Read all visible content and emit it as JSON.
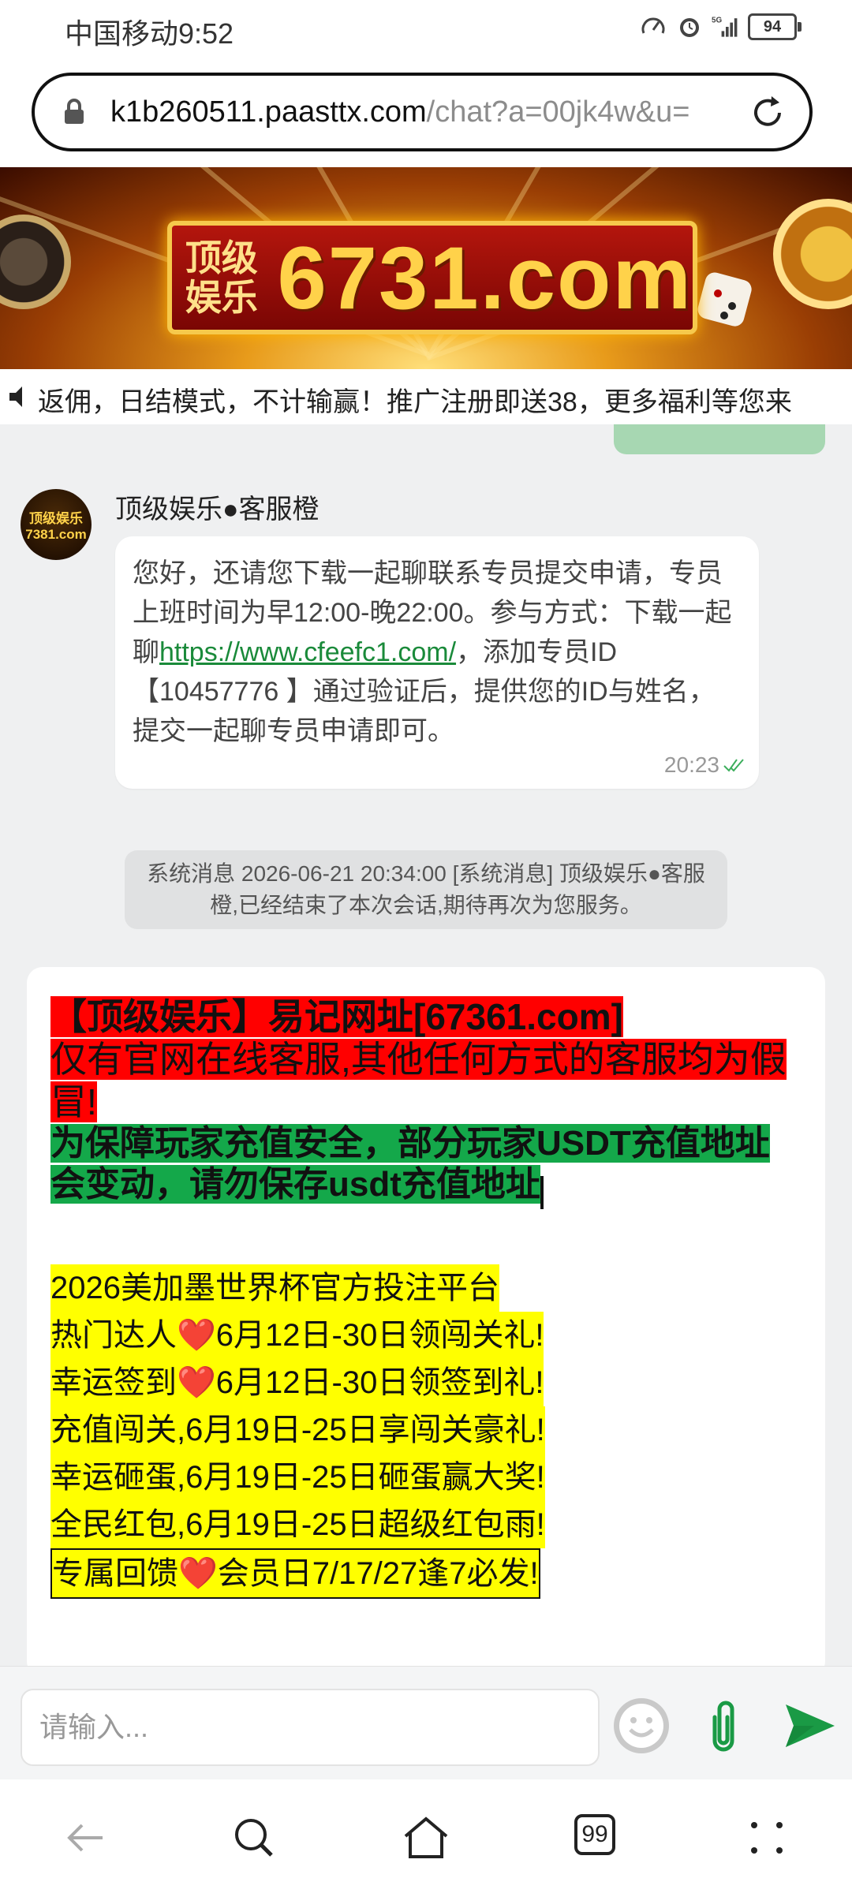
{
  "status_bar": {
    "carrier_time": "中国移动9:52",
    "network": "5G",
    "battery": "94"
  },
  "browser": {
    "url_host": "k1b260511.paasttx.com",
    "url_path": "/chat?a=00jk4w&u="
  },
  "banner": {
    "small_text": "顶级娱乐",
    "big_text": "6731.com"
  },
  "marquee": {
    "text": "返佣，日结模式，不计输赢！推广注册即送38，更多福利等您来"
  },
  "chat": {
    "agent_message": {
      "avatar_text": "顶级娱乐 7381.com",
      "sender": "顶级娱乐●客服橙",
      "text_before_link": "您好，还请您下载一起聊联系专员提交申请，专员上班时间为早12:00-晚22:00。参与方式：下载一起聊",
      "link": "https://www.cfeefc1.com/",
      "text_after_link": "，添加专员ID【10457776 】通过验证后，提供您的ID与姓名，提交一起聊专员申请即可。",
      "time": "20:23"
    },
    "system_message": "系统消息 2026-06-21 20:34:00 [系统消息] 顶级娱乐●客服橙,已经结束了本次会话,期待再次为您服务。",
    "notice": {
      "red_line1": "【顶级娱乐】易记网址[67361.com]",
      "red_line2": "仅有官网在线客服,其他任何方式的客服均为假冒!",
      "green_text": "为保障玩家充值安全，部分玩家USDT充值地址会变动，请勿保存usdt充值地址",
      "yellow_lines": [
        "2026美加墨世界杯官方投注平台",
        "热门达人❤️6月12日-30日领闯关礼!",
        "幸运签到❤️6月12日-30日领签到礼!",
        "充值闯关,6月19日-25日享闯关豪礼!",
        "幸运砸蛋,6月19日-25日砸蛋赢大奖!",
        "全民红包,6月19日-25日超级红包雨!",
        "专属回馈❤️会员日7/17/27逢7必发!"
      ]
    }
  },
  "composer": {
    "placeholder": "请输入..."
  },
  "nav": {
    "tab_count": "99"
  },
  "colors": {
    "brand_green": "#1a9a45",
    "notice_red": "#ff0000",
    "notice_green": "#14a84a",
    "notice_yellow": "#ffff00"
  }
}
